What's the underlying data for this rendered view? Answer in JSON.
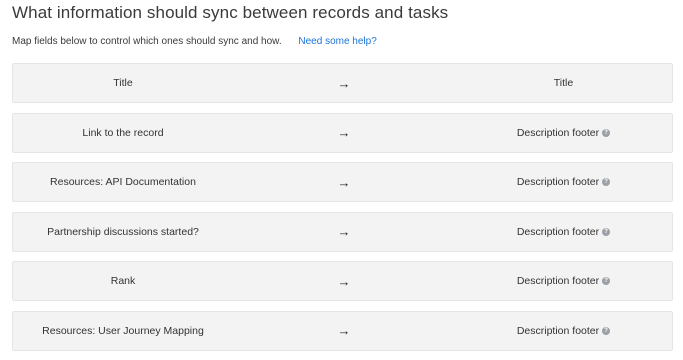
{
  "page": {
    "title": "What information should sync between records and tasks",
    "subtitle": "Map fields below to control which ones should sync and how.",
    "help_link": "Need some help?"
  },
  "mappings": [
    {
      "source": "Title",
      "arrow": "→",
      "target": "Title",
      "has_help": false
    },
    {
      "source": "Link to the record",
      "arrow": "→",
      "target": "Description footer",
      "has_help": true
    },
    {
      "source": "Resources: API Documentation",
      "arrow": "→",
      "target": "Description footer",
      "has_help": true
    },
    {
      "source": "Partnership discussions started?",
      "arrow": "→",
      "target": "Description footer",
      "has_help": true
    },
    {
      "source": "Rank",
      "arrow": "→",
      "target": "Description footer",
      "has_help": true
    },
    {
      "source": "Resources: User Journey Mapping",
      "arrow": "→",
      "target": "Description footer",
      "has_help": true
    }
  ],
  "icons": {
    "help": "question-circle-icon",
    "arrow": "right-arrow-icon"
  },
  "colors": {
    "link": "#1a73d9",
    "row_bg": "#f3f3f3"
  }
}
